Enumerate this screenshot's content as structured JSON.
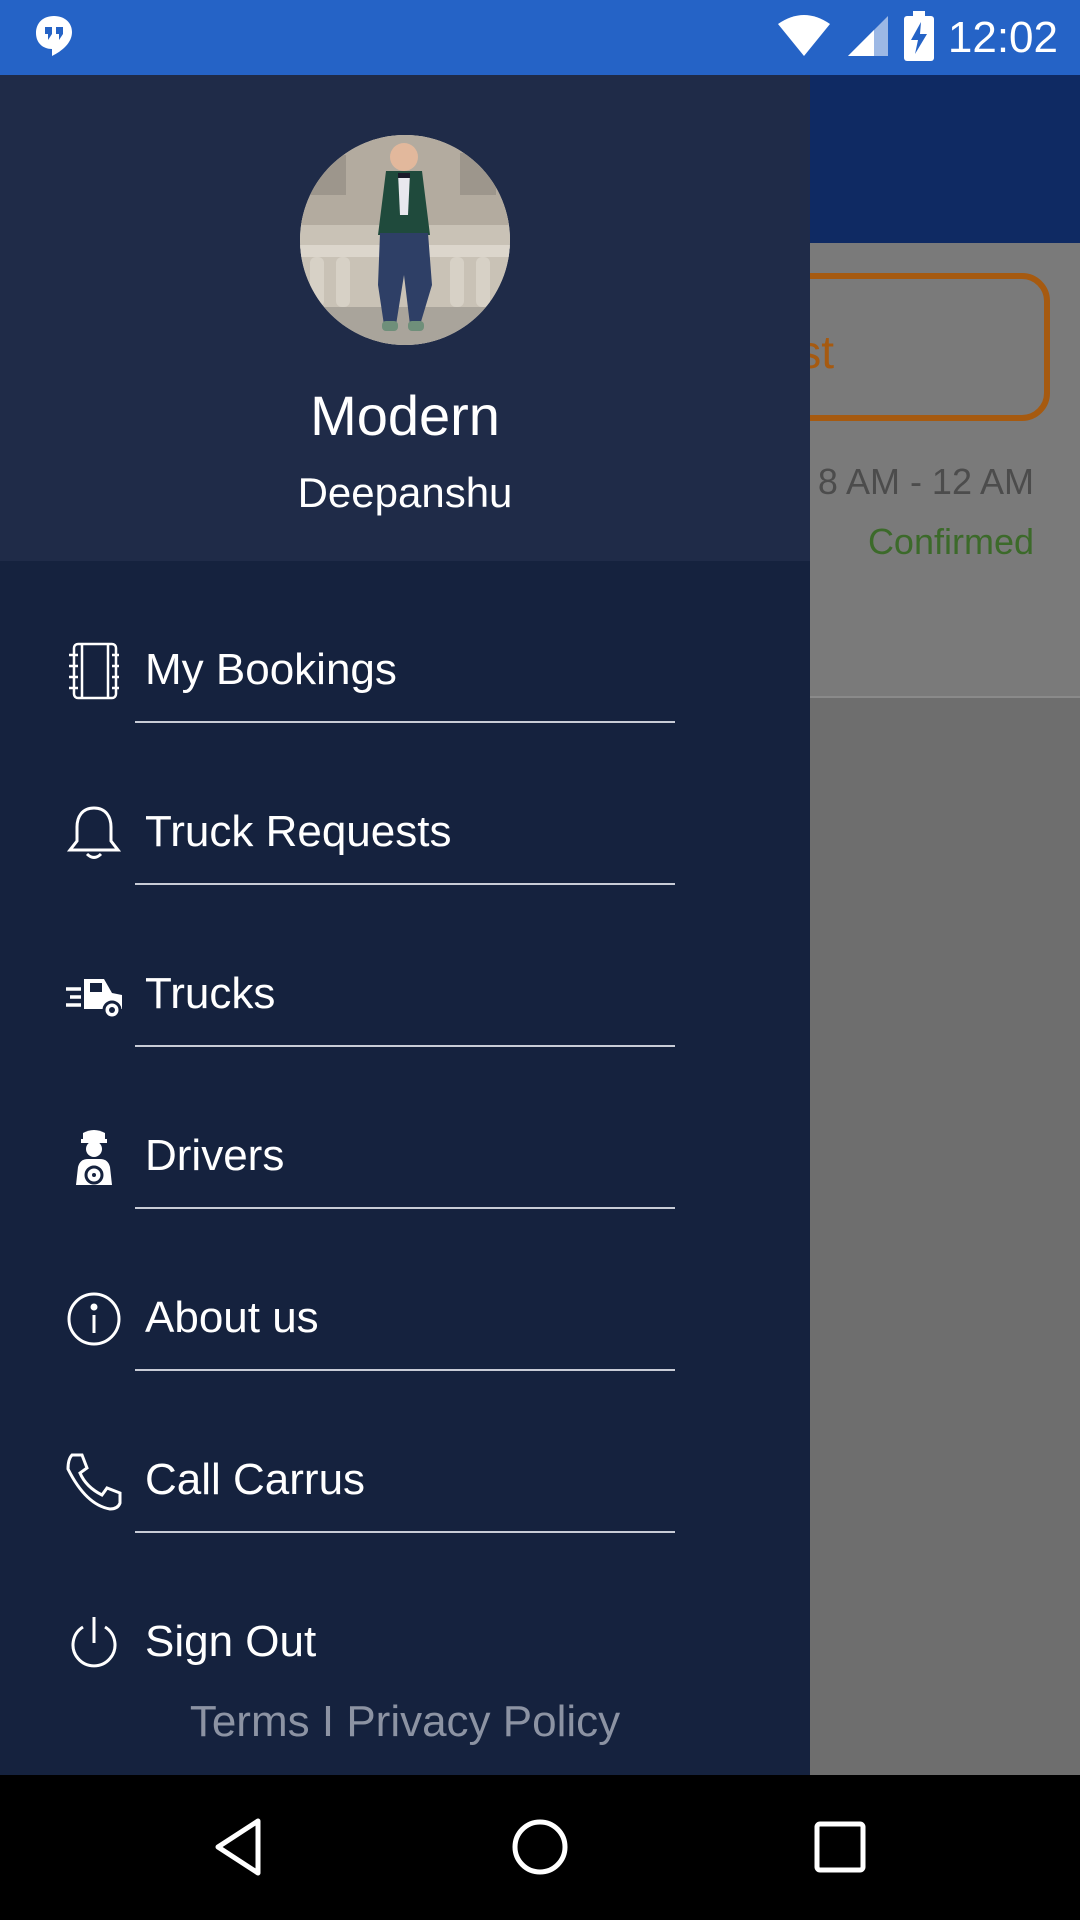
{
  "status_bar": {
    "time": "12:02",
    "icons": [
      "hangouts-icon",
      "wifi-icon",
      "cell-signal-icon",
      "battery-charging-icon"
    ]
  },
  "background_app": {
    "request_button_label": "st",
    "time_slot": "8 AM - 12 AM",
    "booking_status": "Confirmed",
    "status_color": "#3c6a2a"
  },
  "drawer": {
    "profile": {
      "title": "Modern",
      "name": "Deepanshu"
    },
    "menu": [
      {
        "label": "My Bookings",
        "icon": "bookings-notebook-icon"
      },
      {
        "label": "Truck Requests",
        "icon": "bell-icon"
      },
      {
        "label": "Trucks",
        "icon": "truck-icon"
      },
      {
        "label": "Drivers",
        "icon": "driver-icon"
      },
      {
        "label": "About us",
        "icon": "info-icon"
      },
      {
        "label": "Call Carrus",
        "icon": "phone-icon"
      },
      {
        "label": "Sign Out",
        "icon": "power-icon"
      }
    ],
    "footer": {
      "terms": "Terms",
      "separator": "I",
      "privacy": "Privacy Policy"
    }
  },
  "colors": {
    "status_bar": "#2563c6",
    "drawer_bg": "#15223e",
    "drawer_header_bg": "#1f2b48",
    "accent_orange": "#a65a10"
  }
}
